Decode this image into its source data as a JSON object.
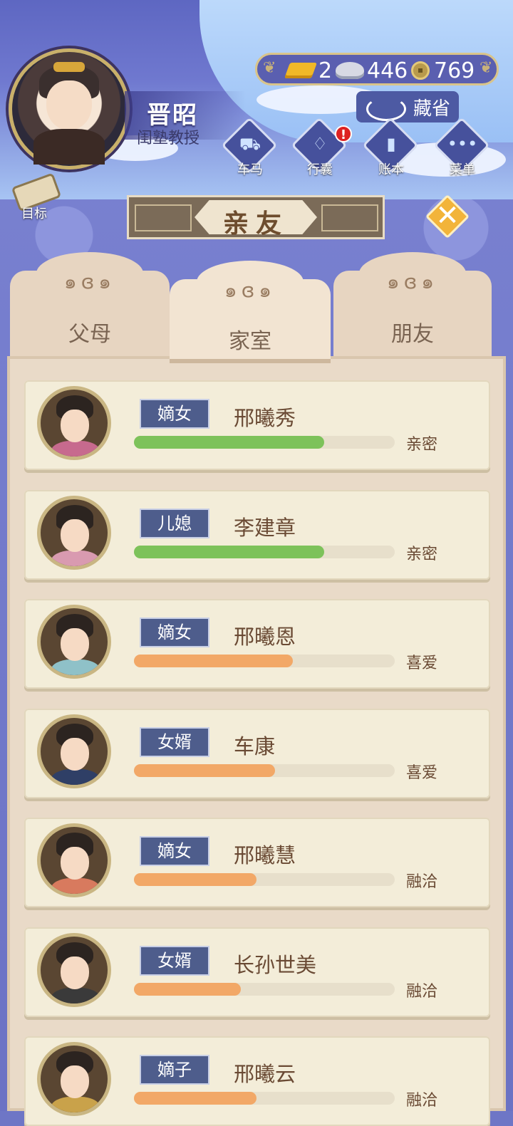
{
  "player": {
    "name": "晋昭",
    "title": "闺塾教授"
  },
  "currency": {
    "gold": "2",
    "silver": "446",
    "coins": "769"
  },
  "top_actions": {
    "collection": "藏省"
  },
  "menu": [
    {
      "label": "车马",
      "icon": "carriage-icon"
    },
    {
      "label": "行囊",
      "icon": "bag-icon",
      "badge": "!"
    },
    {
      "label": "账本",
      "icon": "ledger-icon"
    },
    {
      "label": "菜单",
      "icon": "more-icon"
    }
  ],
  "goal_label": "目标",
  "panel_title": "亲友",
  "tabs": [
    {
      "label": "父母",
      "active": false
    },
    {
      "label": "家室",
      "active": true
    },
    {
      "label": "朋友",
      "active": false
    }
  ],
  "relatives": [
    {
      "role": "嫡女",
      "name": "邢曦秀",
      "relation": "亲密",
      "level": 0.73,
      "color": "#7dc25a"
    },
    {
      "role": "儿媳",
      "name": "李建章",
      "relation": "亲密",
      "level": 0.73,
      "color": "#7dc25a"
    },
    {
      "role": "嫡女",
      "name": "邢曦恩",
      "relation": "喜爱",
      "level": 0.61,
      "color": "#f2a867"
    },
    {
      "role": "女婿",
      "name": "车康",
      "relation": "喜爱",
      "level": 0.54,
      "color": "#f2a867"
    },
    {
      "role": "嫡女",
      "name": "邢曦慧",
      "relation": "融洽",
      "level": 0.47,
      "color": "#f2a867"
    },
    {
      "role": "女婿",
      "name": "长孙世美",
      "relation": "融洽",
      "level": 0.41,
      "color": "#f2a867"
    },
    {
      "role": "嫡子",
      "name": "邢曦云",
      "relation": "融洽",
      "level": 0.47,
      "color": "#f2a867"
    }
  ]
}
